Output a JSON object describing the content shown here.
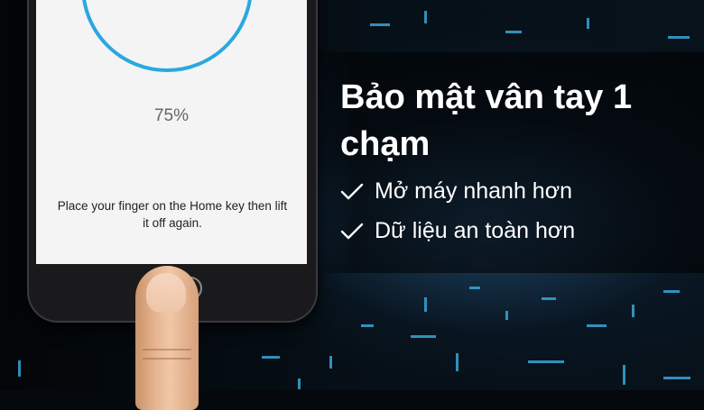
{
  "phone": {
    "progress_percent_label": "75%",
    "progress_value": 0.75,
    "instruction": "Place your finger on the Home key then lift it off again."
  },
  "banner": {
    "headline": "Bảo mật vân tay 1 chạm",
    "features": [
      "Mở máy nhanh hơn",
      "Dữ liệu an toàn hơn"
    ]
  },
  "colors": {
    "progress_ring": "#29a8e0",
    "headline_text": "#ffffff",
    "background": "#05080c"
  },
  "icons": [
    "check-icon",
    "check-icon"
  ]
}
